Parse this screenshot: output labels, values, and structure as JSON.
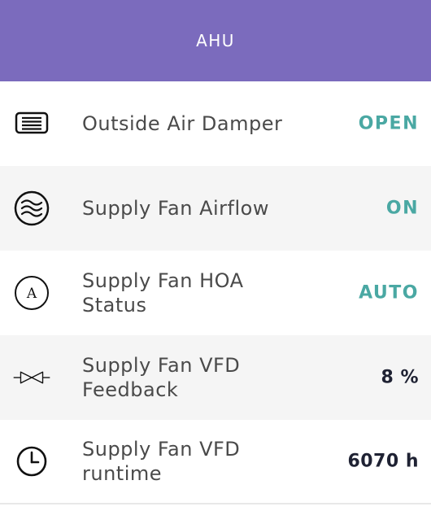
{
  "header": {
    "title": "AHU"
  },
  "points": [
    {
      "label": "Outside Air Damper",
      "value": "OPEN",
      "icon": "damper-icon",
      "kind": "status"
    },
    {
      "label": "Supply Fan Airflow",
      "value": "ON",
      "icon": "airflow-icon",
      "kind": "status"
    },
    {
      "label": "Supply Fan HOA Status",
      "value": "AUTO",
      "icon": "hoa-auto-icon",
      "kind": "status"
    },
    {
      "label": "Supply Fan VFD Feedback",
      "value": "8 %",
      "icon": "valve-icon",
      "kind": "numeric"
    },
    {
      "label": "Supply Fan VFD runtime",
      "value": "6070 h",
      "icon": "clock-icon",
      "kind": "numeric"
    }
  ],
  "colors": {
    "header": "#7b6bbd",
    "status_value": "#4aa8a3",
    "numeric_value": "#1f2233",
    "row_alt": "#f5f5f5"
  }
}
